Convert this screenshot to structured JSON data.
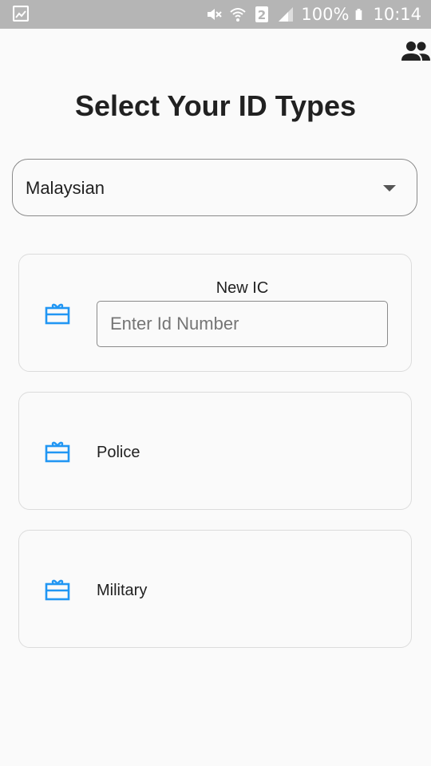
{
  "status_bar": {
    "battery": "100%",
    "time": "10:14",
    "icons": [
      "image-icon",
      "mute-icon",
      "wifi-icon",
      "sim-2-icon",
      "signal-icon",
      "battery-icon"
    ]
  },
  "header": {
    "account_icon": "group-icon"
  },
  "page": {
    "title": "Select Your ID Types"
  },
  "nationality_select": {
    "value": "Malaysian",
    "icon": "caret-down-icon"
  },
  "id_types": [
    {
      "label": "New IC",
      "icon": "id-card-icon",
      "input_placeholder": "Enter Id Number",
      "input_value": ""
    },
    {
      "label": "Police",
      "icon": "id-card-icon"
    },
    {
      "label": "Military",
      "icon": "id-card-icon"
    }
  ],
  "colors": {
    "accent": "#2196f3",
    "status_bar": "#b5b5b5",
    "background": "#fafafa",
    "text": "#212121",
    "card_border": "#dcdcdc"
  }
}
